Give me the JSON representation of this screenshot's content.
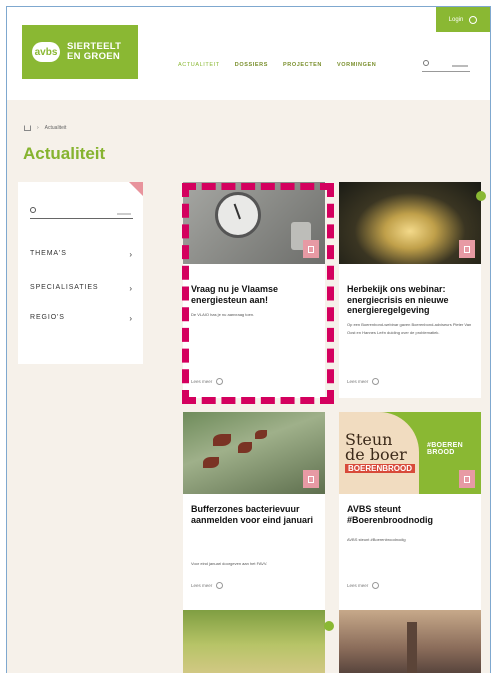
{
  "header": {
    "logo_mark": "avbs",
    "logo_line1": "SIERTEELT",
    "logo_line2": "EN GROEN",
    "logo_sub": "",
    "login_label": "Login",
    "nav": [
      "ACTUALITEIT",
      "DOSSIERS",
      "PROJECTEN",
      "VORMINGEN"
    ]
  },
  "breadcrumb": {
    "current": "Actualiteit"
  },
  "page_title": "Actualiteit",
  "sidebar": {
    "items": [
      {
        "label": "THEMA'S"
      },
      {
        "label": "SPECIALISATIES"
      },
      {
        "label": "REGIO'S"
      }
    ]
  },
  "cards": [
    {
      "title": "Vraag nu je Vlaamse energiesteun aan!",
      "desc": "De VLAIO has je nu aanvraag toen.",
      "more": "Lees meer"
    },
    {
      "title": "Herbekijk ons webinar: energiecrisis en nieuwe energieregelgeving",
      "desc": "Op een Boerenbond-webinar gaven Boerenbond-adviseurs Pieter Van Oost en Hannes Leën duiding over de problematiek.",
      "more": "Lees meer"
    },
    {
      "title": "Bufferzones bacterievuur aanmelden voor eind januari",
      "desc": "Voor eind januari doorgeven aan het FAVV.",
      "more": "Lees meer"
    },
    {
      "title": "AVBS steunt #Boerenbroodnodig",
      "desc": "AVBS steunt #Boerenbroodnodig",
      "more": "Lees meer"
    }
  ],
  "bread_image": {
    "line1": "Steun",
    "line2": "de boer",
    "red": "BOERENBROOD",
    "tag": "#BOEREN BROOD"
  },
  "colors": {
    "brand_green": "#8ab833",
    "highlight": "#d4005e",
    "badge_pink": "#e79aa4"
  }
}
